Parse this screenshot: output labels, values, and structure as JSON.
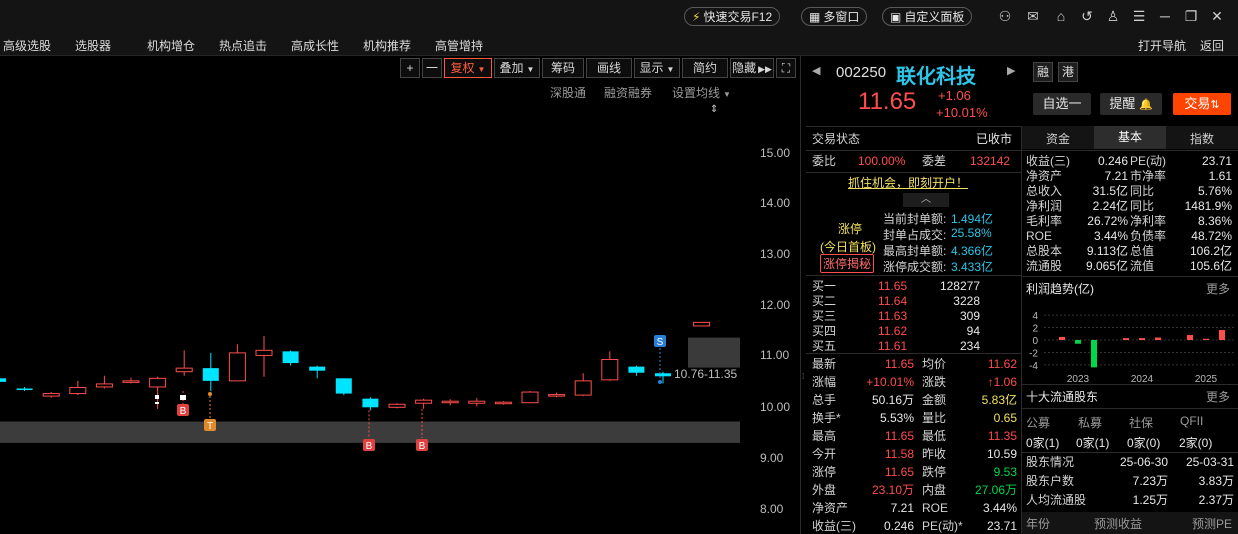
{
  "topbar": {
    "quick_trade": "快速交易F12",
    "multi_window": "多窗口",
    "custom_panel": "自定义面板",
    "icons": [
      "user-icon",
      "mail-icon",
      "home-icon",
      "back-icon",
      "shirt-icon",
      "menu-icon",
      "minimize-icon",
      "restore-icon",
      "close-icon"
    ]
  },
  "nav": {
    "items": [
      "高级选股",
      "选股器",
      "机构增仓",
      "热点追击",
      "高成长性",
      "机构推荐",
      "高管增持"
    ],
    "right": [
      "打开导航",
      "返回"
    ]
  },
  "chart_toolbar": {
    "plus": "+",
    "minus": "一",
    "fuquan": "复权",
    "diejia": "叠加",
    "chouma": "筹码",
    "huaxian": "画线",
    "xianshi": "显示",
    "jianyue": "简约",
    "yincang": "隐藏",
    "subbar": [
      "深股通",
      "融资融券",
      "设置均线"
    ]
  },
  "chart_data": {
    "type": "candlestick",
    "y_ticks": [
      "15.00",
      "14.00",
      "13.00",
      "12.00",
      "11.00",
      "10.00",
      "9.00",
      "8.00"
    ],
    "ylim": [
      7.8,
      15.2
    ],
    "price_range_label": "10.76-11.35",
    "markers": [
      "B",
      "T",
      "B",
      "B",
      "S"
    ],
    "candles": [
      {
        "o": 10.55,
        "c": 10.48,
        "h": 10.55,
        "l": 10.45
      },
      {
        "o": 10.35,
        "c": 10.33,
        "h": 10.38,
        "l": 10.3
      },
      {
        "o": 10.2,
        "c": 10.25,
        "h": 10.28,
        "l": 10.17
      },
      {
        "o": 10.25,
        "c": 10.37,
        "h": 10.5,
        "l": 10.22
      },
      {
        "o": 10.38,
        "c": 10.44,
        "h": 10.6,
        "l": 10.35
      },
      {
        "o": 10.48,
        "c": 10.5,
        "h": 10.56,
        "l": 10.45
      },
      {
        "o": 10.38,
        "c": 10.55,
        "h": 10.58,
        "l": 9.95
      },
      {
        "o": 10.68,
        "c": 10.75,
        "h": 11.1,
        "l": 10.6
      },
      {
        "o": 10.75,
        "c": 10.5,
        "h": 11.05,
        "l": 10.3
      },
      {
        "o": 10.5,
        "c": 11.05,
        "h": 11.22,
        "l": 10.5
      },
      {
        "o": 11.0,
        "c": 11.1,
        "h": 11.38,
        "l": 10.58
      },
      {
        "o": 11.08,
        "c": 10.85,
        "h": 11.1,
        "l": 10.8
      },
      {
        "o": 10.78,
        "c": 10.7,
        "h": 10.8,
        "l": 10.55
      },
      {
        "o": 10.55,
        "c": 10.25,
        "h": 10.55,
        "l": 10.22
      },
      {
        "o": 10.15,
        "c": 9.98,
        "h": 10.18,
        "l": 9.92
      },
      {
        "o": 9.98,
        "c": 10.04,
        "h": 10.06,
        "l": 9.96
      },
      {
        "o": 10.06,
        "c": 10.12,
        "h": 10.15,
        "l": 9.95
      },
      {
        "o": 10.08,
        "c": 10.1,
        "h": 10.14,
        "l": 10.02
      },
      {
        "o": 10.06,
        "c": 10.1,
        "h": 10.16,
        "l": 10.0
      },
      {
        "o": 10.06,
        "c": 10.08,
        "h": 10.1,
        "l": 10.03
      },
      {
        "o": 10.07,
        "c": 10.28,
        "h": 10.3,
        "l": 10.07
      },
      {
        "o": 10.2,
        "c": 10.23,
        "h": 10.27,
        "l": 10.18
      },
      {
        "o": 10.22,
        "c": 10.5,
        "h": 10.65,
        "l": 10.2
      },
      {
        "o": 10.52,
        "c": 10.92,
        "h": 11.08,
        "l": 10.5
      },
      {
        "o": 10.78,
        "c": 10.66,
        "h": 10.8,
        "l": 10.6
      },
      {
        "o": 10.65,
        "c": 10.59,
        "h": 10.68,
        "l": 10.45
      },
      {
        "o": 11.58,
        "c": 11.65,
        "h": 11.65,
        "l": 11.58
      }
    ]
  },
  "stock": {
    "code": "002250",
    "name": "联化科技",
    "tags": [
      "融",
      "港"
    ],
    "price": "11.65",
    "change": "+1.06",
    "pct": "+10.01%",
    "btn_zixuan": "自选一",
    "btn_tixing": "提醒",
    "btn_jiaoyi": "交易"
  },
  "status": {
    "label": "交易状态",
    "value": "已收市",
    "weibi_l": "委比",
    "weibi": "100.00%",
    "weicha_l": "委差",
    "weicha": "132142",
    "ad": "抓住机会，即刻开户！"
  },
  "limitup": {
    "title": "涨停",
    "sub": "(今日首板)",
    "btn": "涨停揭秘",
    "rows": [
      {
        "label": "当前封单额:",
        "value": "1.494亿"
      },
      {
        "label": "封单占成交:",
        "value": "25.58%"
      },
      {
        "label": "最高封单额:",
        "value": "4.366亿"
      },
      {
        "label": "涨停成交额:",
        "value": "3.433亿"
      }
    ]
  },
  "orderbook": [
    {
      "label": "买一",
      "price": "11.65",
      "vol": "128277"
    },
    {
      "label": "买二",
      "price": "11.64",
      "vol": "3228"
    },
    {
      "label": "买三",
      "price": "11.63",
      "vol": "309"
    },
    {
      "label": "买四",
      "price": "11.62",
      "vol": "94"
    },
    {
      "label": "买五",
      "price": "11.61",
      "vol": "234"
    }
  ],
  "quote": [
    {
      "l1": "最新",
      "v1": "11.65",
      "c1": "r",
      "l2": "均价",
      "v2": "11.62",
      "c2": "r"
    },
    {
      "l1": "涨幅",
      "v1": "+10.01%",
      "c1": "r",
      "l2": "涨跌",
      "v2": "↑1.06",
      "c2": "r"
    },
    {
      "l1": "总手",
      "v1": "50.16万",
      "c1": "w",
      "l2": "金额",
      "v2": "5.83亿",
      "c2": "yl"
    },
    {
      "l1": "换手*",
      "v1": "5.53%",
      "c1": "w",
      "l2": "量比",
      "v2": "0.65",
      "c2": "yl"
    },
    {
      "l1": "最高",
      "v1": "11.65",
      "c1": "r",
      "l2": "最低",
      "v2": "11.35",
      "c2": "r"
    },
    {
      "l1": "今开",
      "v1": "11.58",
      "c1": "r",
      "l2": "昨收",
      "v2": "10.59",
      "c2": "w"
    },
    {
      "l1": "涨停",
      "v1": "11.65",
      "c1": "r",
      "l2": "跌停",
      "v2": "9.53",
      "c2": "g"
    },
    {
      "l1": "外盘",
      "v1": "23.10万",
      "c1": "r",
      "l2": "内盘",
      "v2": "27.06万",
      "c2": "g"
    },
    {
      "l1": "净资产",
      "v1": "7.21",
      "c1": "w",
      "l2": "ROE",
      "v2": "3.44%",
      "c2": "w"
    },
    {
      "l1": "收益(三)",
      "v1": "0.246",
      "c1": "w",
      "l2": "PE(动)*",
      "v2": "23.71",
      "c2": "w"
    }
  ],
  "fund_tabs": [
    "资金",
    "基本",
    "指数"
  ],
  "fundamentals": [
    {
      "l1": "收益(三)",
      "v1": "0.246",
      "l2": "PE(动)",
      "v2": "23.71"
    },
    {
      "l1": "净资产",
      "v1": "7.21",
      "l2": "市净率",
      "v2": "1.61"
    },
    {
      "l1": "总收入",
      "v1": "31.5亿",
      "l2": "同比",
      "v2": "5.76%"
    },
    {
      "l1": "净利润",
      "v1": "2.24亿",
      "l2": "同比",
      "v2": "1481.9%"
    },
    {
      "l1": "毛利率",
      "v1": "26.72%",
      "l2": "净利率",
      "v2": "8.36%"
    },
    {
      "l1": "ROE",
      "v1": "3.44%",
      "l2": "负债率",
      "v2": "48.72%"
    },
    {
      "l1": "总股本",
      "v1": "9.113亿",
      "l2": "总值",
      "v2": "106.2亿"
    },
    {
      "l1": "流通股",
      "v1": "9.065亿",
      "l2": "流值",
      "v2": "105.6亿"
    }
  ],
  "profit_trend": {
    "title": "利润趋势(亿)",
    "more": "更多",
    "y_ticks": [
      "4",
      "2",
      "0",
      "-2",
      "-4"
    ],
    "x_labels": [
      "2023",
      "2024",
      "2025"
    ],
    "bars": [
      0.5,
      -0.6,
      -4.4,
      0.3,
      0.3,
      0.4,
      0.8,
      0.2,
      1.6
    ]
  },
  "holders": {
    "title": "十大流通股东",
    "more": "更多",
    "cats": [
      "公募",
      "私募",
      "社保",
      "QFII"
    ],
    "counts": [
      "0家(1)",
      "0家(1)",
      "0家(0)",
      "2家(0)"
    ],
    "rows": [
      {
        "label": "股东情况",
        "v1": "25-06-30",
        "v2": "25-03-31"
      },
      {
        "label": "股东户数",
        "v1": "7.23万",
        "v2": "3.83万"
      },
      {
        "label": "人均流通股",
        "v1": "1.25万",
        "v2": "2.37万"
      }
    ],
    "footer": [
      "年份",
      "预测收益",
      "预测PE"
    ]
  }
}
